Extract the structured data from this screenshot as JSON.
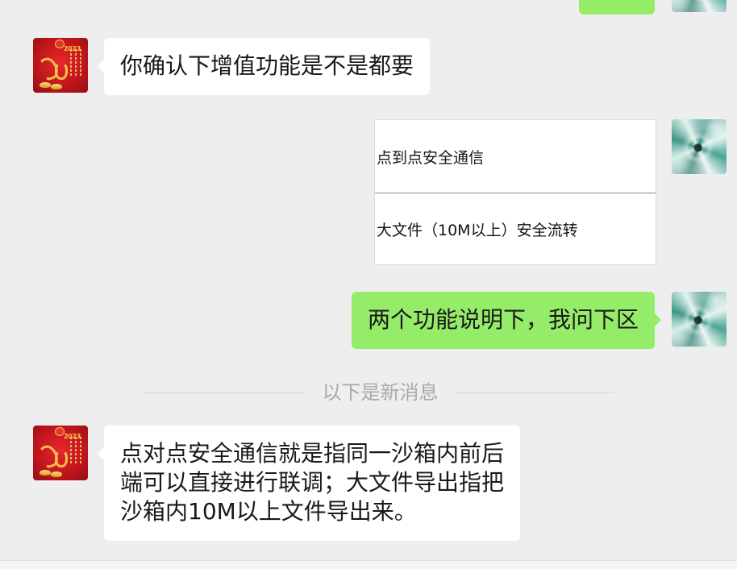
{
  "colors": {
    "background": "#eeeeee",
    "bubble_self": "#95ec69",
    "bubble_other": "#ffffff",
    "divider_text": "#aaaaaa",
    "text": "#191919"
  },
  "avatars": {
    "contact": {
      "icon": "new-year-red-avatar",
      "badge": "2023"
    },
    "self": {
      "icon": "teal-wave-avatar"
    }
  },
  "messages": [
    {
      "sender": "self",
      "type": "text",
      "clipped": true
    },
    {
      "sender": "contact",
      "type": "text",
      "text": "你确认下增值功能是不是都要"
    },
    {
      "sender": "self",
      "type": "image",
      "rows": [
        "点到点安全通信",
        "大文件（10M以上）安全流转"
      ]
    },
    {
      "sender": "self",
      "type": "text",
      "text": "两个功能说明下，我问下区"
    },
    {
      "sender": "contact",
      "type": "text",
      "lines": [
        "点对点安全通信就是指同一沙箱内前后",
        "端可以直接进行联调；大文件导出指把",
        "沙箱内10M以上文件导出来。"
      ]
    }
  ],
  "new_messages_divider": "以下是新消息"
}
